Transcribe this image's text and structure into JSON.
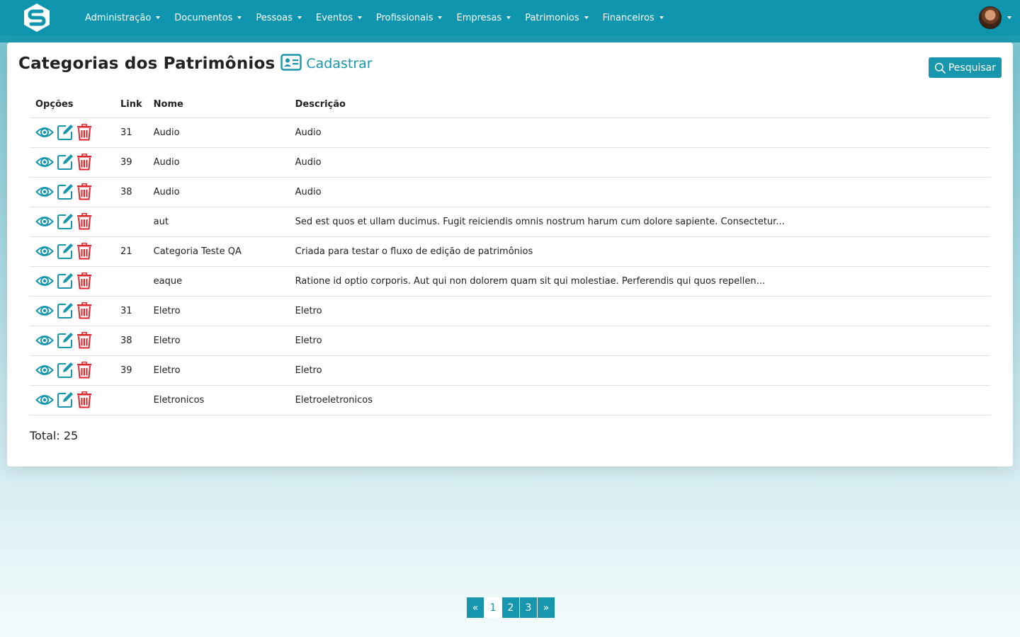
{
  "navbar": {
    "logo_icon": "s-hexagon-logo",
    "menu": [
      {
        "label": "Administração"
      },
      {
        "label": "Documentos"
      },
      {
        "label": "Pessoas"
      },
      {
        "label": "Eventos"
      },
      {
        "label": "Profissionais"
      },
      {
        "label": "Empresas"
      },
      {
        "label": "Patrimonios"
      },
      {
        "label": "Financeiros"
      }
    ]
  },
  "page": {
    "title": "Categorias dos Patrimônios",
    "create_label": "Cadastrar",
    "search_label": "Pesquisar"
  },
  "table": {
    "headers": {
      "options": "Opções",
      "link": "Link",
      "name": "Nome",
      "description": "Descrição"
    },
    "rows": [
      {
        "link": "31",
        "name": "Audio",
        "description": "Audio"
      },
      {
        "link": "39",
        "name": "Audio",
        "description": "Audio"
      },
      {
        "link": "38",
        "name": "Audio",
        "description": "Audio"
      },
      {
        "link": "",
        "name": "aut",
        "description": "Sed est quos et ullam ducimus. Fugit reiciendis omnis nostrum harum cum dolore sapiente. Consectetur..."
      },
      {
        "link": "21",
        "name": "Categoria Teste QA",
        "description": "Criada para testar o fluxo de edição de patrimônios"
      },
      {
        "link": "",
        "name": "eaque",
        "description": "Ratione id optio corporis. Aut qui non dolorem quam sit qui molestiae. Perferendis qui quos repellen..."
      },
      {
        "link": "31",
        "name": "Eletro",
        "description": "Eletro"
      },
      {
        "link": "38",
        "name": "Eletro",
        "description": "Eletro"
      },
      {
        "link": "39",
        "name": "Eletro",
        "description": "Eletro"
      },
      {
        "link": "",
        "name": "Eletronicos",
        "description": "Eletroeletronicos"
      }
    ],
    "total": "Total: 25"
  },
  "pagination": {
    "prev": "«",
    "pages": [
      "1",
      "2",
      "3"
    ],
    "next": "»",
    "current": "1"
  },
  "colors": {
    "primary": "#1796ad",
    "navbar": "#0f95ae",
    "danger": "#e0262b"
  }
}
